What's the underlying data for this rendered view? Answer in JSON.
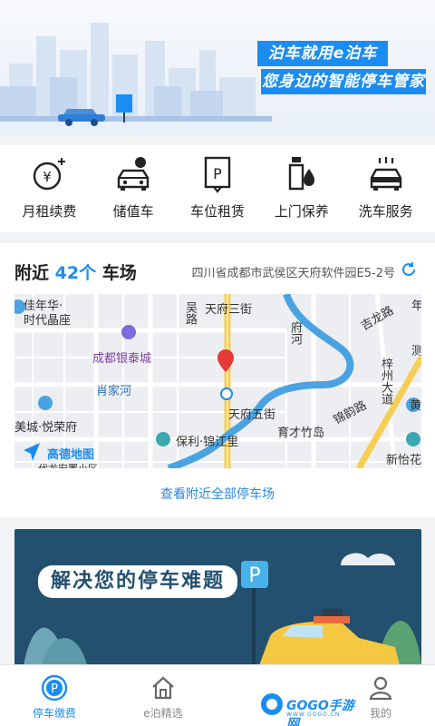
{
  "hero": {
    "slogan_1": "泊车就用e泊车",
    "slogan_2": "您身边的智能停车管家",
    "sign": "P"
  },
  "services": [
    {
      "label": "月租续费",
      "icon": "monthly-renew-icon",
      "glyph": "¥"
    },
    {
      "label": "储值车",
      "icon": "stored-value-car-icon"
    },
    {
      "label": "车位租赁",
      "icon": "parking-lease-icon",
      "glyph": "P"
    },
    {
      "label": "上门保养",
      "icon": "maintenance-oil-icon"
    },
    {
      "label": "洗车服务",
      "icon": "car-wash-icon"
    }
  ],
  "nearby": {
    "prefix": "附近",
    "count": "42个",
    "suffix": "车场",
    "address": "四川省成都市武侯区天府软件园E5-2号",
    "view_all": "查看附近全部停车场"
  },
  "map": {
    "labels": {
      "jianianhua": "佳年华·",
      "shidaijingzuo": "时代晶座",
      "chengduyintai": "成都银泰城",
      "xiaojiahe": "肖家河",
      "meicheng": "美城·悦荣府",
      "baoli": "保利·锦江里",
      "tianfusanjie": "天府三街",
      "tianfuwujie": "天府五街",
      "yucaizhudao": "育才竹岛",
      "jinyunlu": "锦韵路",
      "jilonglu": "吉龙路",
      "fuhe": "府河",
      "yuncheng": "吴路",
      "zizhou": "梓州大道",
      "xinyi": "新怡花",
      "huang": "黄",
      "ce": "测",
      "nian": "年",
      "tianfu_logo": "高德地图",
      "cutoff": "代龙安置小区"
    }
  },
  "promo": {
    "title": "解决您的停车难题",
    "sign": "P"
  },
  "tabs": [
    {
      "label": "停车缴费",
      "icon": "parking-pay-icon",
      "active": true
    },
    {
      "label": "e泊精选",
      "icon": "home-icon",
      "active": false
    },
    {
      "label": "",
      "icon": "",
      "active": false
    },
    {
      "label": "我的",
      "icon": "user-icon",
      "active": false
    }
  ],
  "watermark": {
    "text": "GOGO手游网",
    "sub": "WWW.GOGO.CN"
  },
  "colors": {
    "accent": "#1c8df0",
    "promo_bg": "#24506f",
    "marker": "#e53935"
  }
}
